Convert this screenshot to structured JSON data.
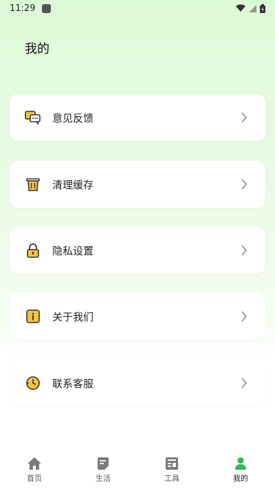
{
  "status_bar": {
    "time": "11:29"
  },
  "header": {
    "title": "我的"
  },
  "menu": [
    {
      "label": "意见反馈",
      "icon": "feedback-chat-icon"
    },
    {
      "label": "清理缓存",
      "icon": "trash-bin-icon"
    },
    {
      "label": "隐私设置",
      "icon": "lock-icon"
    },
    {
      "label": "关于我们",
      "icon": "info-icon"
    },
    {
      "label": "联系客服",
      "icon": "clock-service-icon"
    }
  ],
  "tab_bar": {
    "tabs": [
      {
        "label": "首页",
        "icon": "home-icon"
      },
      {
        "label": "生活",
        "icon": "note-icon"
      },
      {
        "label": "工具",
        "icon": "toolbox-icon"
      },
      {
        "label": "我的",
        "icon": "person-icon",
        "active": true
      }
    ]
  },
  "colors": {
    "accent": "#2fb85a",
    "icon_yellow": "#f5c23c",
    "tab_gray": "#7a7a7a"
  }
}
